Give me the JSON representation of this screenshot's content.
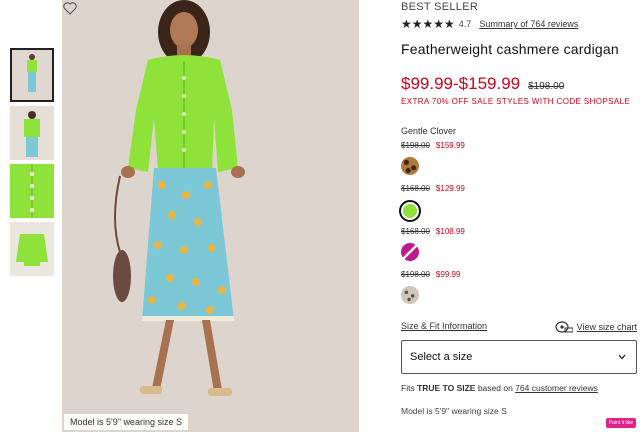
{
  "gallery": {
    "model_caption": "Model is 5'9\" wearing size S",
    "thumbnails": [
      "thumbnail-1",
      "thumbnail-2",
      "thumbnail-3",
      "thumbnail-4"
    ],
    "active_thumbnail": 0
  },
  "product": {
    "badge": "BEST SELLER",
    "rating_value": "4.7",
    "stars": "★★★★★",
    "reviews_link": "Summary of 764 reviews",
    "title": "Featherweight cashmere cardigan",
    "price": "$99.99-$159.99",
    "original_price": "$198.00",
    "promo": "EXTRA 70% OFF SALE STYLES WITH CODE SHOPSALE",
    "color_name": "Gentle Clover",
    "swatches": [
      {
        "old": "$198.00",
        "new": "$159.99",
        "color_name": "leopard",
        "selected": false
      },
      {
        "old": "$168.00",
        "new": "$129.99",
        "color_name": "gentle-clover",
        "selected": true
      },
      {
        "old": "$168.00",
        "new": "$108.99",
        "color_name": "magenta-stripe",
        "selected": false
      },
      {
        "old": "$198.00",
        "new": "$99.99",
        "color_name": "snow-leopard",
        "selected": false
      }
    ],
    "size_fit_link": "Size & Fit Information",
    "size_chart_link": "View size chart",
    "size_select_placeholder": "Select a size",
    "fits_prefix": "Fits ",
    "fits_bold": "TRUE TO SIZE",
    "fits_mid": " based on ",
    "fits_link": "764 customer reviews",
    "model_wear": "Model is 5'9\" wearing size S",
    "extension_badge": "Paint it like"
  },
  "colors": {
    "sale_red": "#d0021b",
    "cardigan_green": "#8ee23a",
    "skirt_blue": "#7cc8d6"
  }
}
